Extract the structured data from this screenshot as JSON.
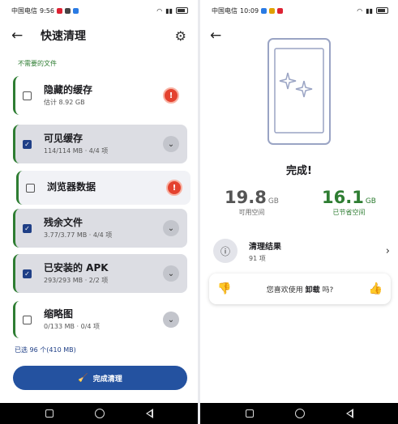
{
  "left": {
    "status": {
      "carrier": "中国电信",
      "time": "9:56",
      "battery": "100"
    },
    "header": {
      "title": "快速清理"
    },
    "section_label": "不需要的文件",
    "items": [
      {
        "name": "隐藏的缓存",
        "detail": "估计 8.92 GB",
        "checked": false,
        "action": "warning"
      },
      {
        "name": "可见缓存",
        "detail": "114/114 MB · 4/4 项",
        "checked": true,
        "action": "expand"
      },
      {
        "name": "浏览器数据",
        "detail": "",
        "checked": false,
        "action": "warning"
      },
      {
        "name": "残余文件",
        "detail": "3.77/3.77 MB · 4/4 项",
        "checked": true,
        "action": "expand"
      },
      {
        "name": "已安装的 APK",
        "detail": "293/293 MB · 2/2 项",
        "checked": true,
        "action": "expand"
      },
      {
        "name": "缩略图",
        "detail": "0/133 MB · 0/4 项",
        "checked": false,
        "action": "expand"
      }
    ],
    "selected_summary": "已选 96 个(410 MB)",
    "clean_button": "完成清理"
  },
  "right": {
    "status": {
      "carrier": "中国电信",
      "time": "10:09",
      "battery": "100"
    },
    "done_title": "完成!",
    "free": {
      "value": "19.8",
      "unit": "GB",
      "label": "可用空间"
    },
    "saved": {
      "value": "16.1",
      "unit": "GB",
      "label": "已节省空间"
    },
    "result": {
      "title": "清理结果",
      "count": "91 项"
    },
    "feedback": {
      "prefix": "您喜欢使用",
      "app": "卸载",
      "suffix": "吗?"
    }
  },
  "colors": {
    "accent_blue": "#2452a0",
    "accent_green": "#2e7d32",
    "warning_red": "#e4422f"
  },
  "icons": [
    "back-arrow-icon",
    "gear-icon",
    "chevron-down-icon",
    "warning-icon",
    "broom-icon",
    "info-icon",
    "chevron-right-icon",
    "thumbs-down-icon",
    "thumbs-up-icon",
    "phone-sparkle-icon"
  ]
}
